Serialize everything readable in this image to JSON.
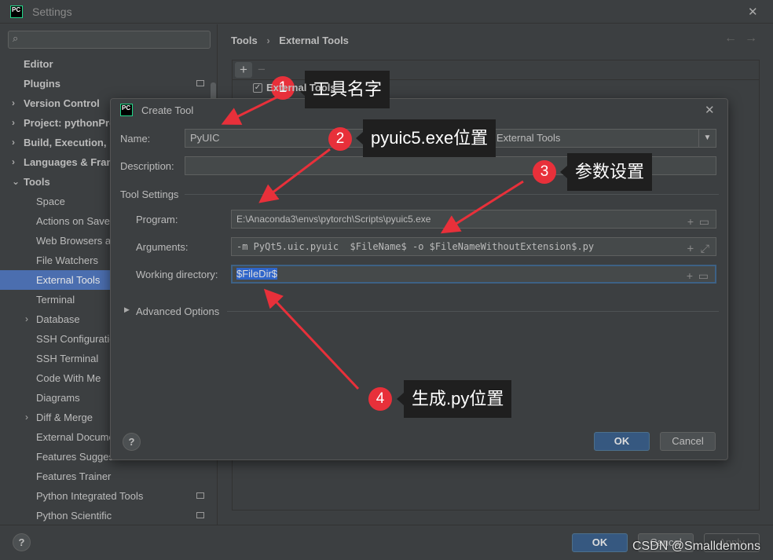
{
  "window": {
    "title": "Settings",
    "close": "✕",
    "logo": "PC"
  },
  "sidebar": {
    "items": [
      {
        "label": "Editor",
        "type": "bold"
      },
      {
        "label": "Plugins",
        "type": "bold",
        "mini": true
      },
      {
        "label": "Version Control",
        "type": "bold",
        "chev": "›"
      },
      {
        "label": "Project: pythonProject",
        "type": "bold",
        "chev": "›"
      },
      {
        "label": "Build, Execution, Deployment",
        "type": "bold",
        "chev": "›"
      },
      {
        "label": "Languages & Frameworks",
        "type": "bold",
        "chev": "›"
      },
      {
        "label": "Tools",
        "type": "bold",
        "chev": "⌄"
      },
      {
        "label": "Space",
        "type": "sub"
      },
      {
        "label": "Actions on Save",
        "type": "sub"
      },
      {
        "label": "Web Browsers and Preview",
        "type": "sub"
      },
      {
        "label": "File Watchers",
        "type": "sub"
      },
      {
        "label": "External Tools",
        "type": "sub",
        "selected": true
      },
      {
        "label": "Terminal",
        "type": "sub"
      },
      {
        "label": "Database",
        "type": "sub",
        "chev": "›"
      },
      {
        "label": "SSH Configurations",
        "type": "sub"
      },
      {
        "label": "SSH Terminal",
        "type": "sub"
      },
      {
        "label": "Code With Me",
        "type": "sub"
      },
      {
        "label": "Diagrams",
        "type": "sub"
      },
      {
        "label": "Diff & Merge",
        "type": "sub",
        "chev": "›"
      },
      {
        "label": "External Documentation",
        "type": "sub"
      },
      {
        "label": "Features Suggester",
        "type": "sub"
      },
      {
        "label": "Features Trainer",
        "type": "sub"
      },
      {
        "label": "Python Integrated Tools",
        "type": "sub",
        "mini": true
      },
      {
        "label": "Python Scientific",
        "type": "sub",
        "mini": true
      }
    ]
  },
  "breadcrumb": {
    "parent": "Tools",
    "sep": "›",
    "current": "External Tools",
    "back": "←",
    "forward": "→"
  },
  "toolbar": {
    "add": "+",
    "remove": "−"
  },
  "tree": {
    "group": "External Tools"
  },
  "footer": {
    "help": "?",
    "ok": "OK",
    "cancel": "Cancel",
    "apply": "Apply"
  },
  "dialog": {
    "title": "Create Tool",
    "close": "✕",
    "name_label": "Name:",
    "name_value": "PyUIC",
    "group_value": "External Tools",
    "description_label": "Description:",
    "description_value": "",
    "tool_settings": "Tool Settings",
    "program_label": "Program:",
    "program_value": "E:\\Anaconda3\\envs\\pytorch\\Scripts\\pyuic5.exe",
    "arguments_label": "Arguments:",
    "arguments_value": "-m PyQt5.uic.pyuic  $FileName$ -o $FileNameWithoutExtension$.py",
    "workdir_label": "Working directory:",
    "workdir_value": "$FileDir$",
    "advanced": "Advanced Options",
    "help": "?",
    "ok": "OK",
    "cancel": "Cancel"
  },
  "annotations": [
    {
      "num": "1",
      "text": "工具名字"
    },
    {
      "num": "2",
      "text": "pyuic5.exe位置"
    },
    {
      "num": "3",
      "text": "参数设置"
    },
    {
      "num": "4",
      "text": "生成.py位置"
    }
  ],
  "watermark": "CSDN @Smalldemons",
  "colors": {
    "selection": "#4b6eaf",
    "primary_button": "#365880",
    "annotation_red": "#e8303a"
  }
}
